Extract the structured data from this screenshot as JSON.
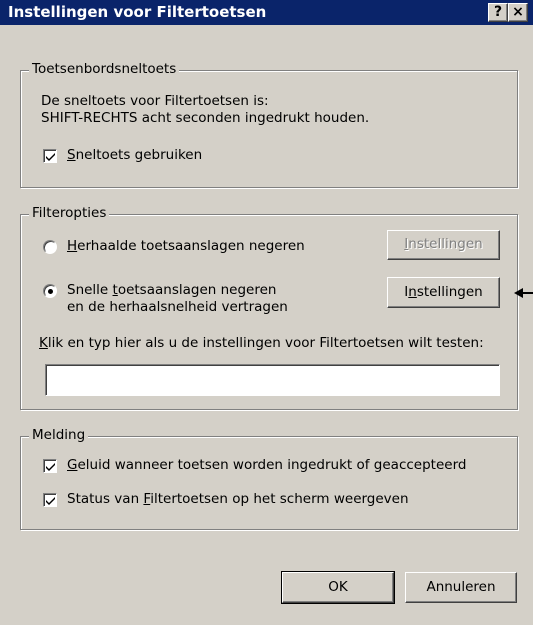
{
  "window": {
    "title": "Instellingen voor Filtertoetsen",
    "help_button": "?",
    "close_button": "×"
  },
  "shortcut_group": {
    "legend": "Toetsenbordsneltoets",
    "line1": "De sneltoets voor Filtertoetsen is:",
    "line2": "SHIFT-RECHTS acht seconden ingedrukt houden.",
    "use_shortcut": {
      "access_key": "S",
      "label_rest": "neltoets gebruiken",
      "checked": true
    }
  },
  "filter_group": {
    "legend": "Filteropties",
    "option_repeat": {
      "access_key": "H",
      "label_rest": "erhaalde toetsaanslagen negeren",
      "selected": false,
      "settings_button": {
        "pre": "",
        "access_key": "I",
        "post": "nstellingen",
        "enabled": false
      }
    },
    "option_slow": {
      "line1_pre": "Snelle ",
      "access_key": "t",
      "line1_post": "oetsaanslagen negeren",
      "line2": "en de herhaalsnelheid vertragen",
      "selected": true,
      "settings_button": {
        "pre": "I",
        "access_key": "n",
        "post": "stellingen",
        "enabled": true
      }
    },
    "test_prompt": {
      "access_key": "K",
      "label_rest": "lik en typ hier als u de instellingen voor Filtertoetsen wilt testen:"
    },
    "test_input_value": ""
  },
  "notify_group": {
    "legend": "Melding",
    "sound": {
      "access_key": "G",
      "label_rest": "eluid wanneer toetsen worden ingedrukt of geaccepteerd",
      "checked": true
    },
    "status": {
      "pre": "Status van ",
      "access_key": "F",
      "post": "iltertoetsen op het scherm weergeven",
      "checked": true
    }
  },
  "buttons": {
    "ok": "OK",
    "cancel": "Annuleren"
  },
  "colors": {
    "titlebar": "#0a246a",
    "face": "#d4d0c8"
  }
}
